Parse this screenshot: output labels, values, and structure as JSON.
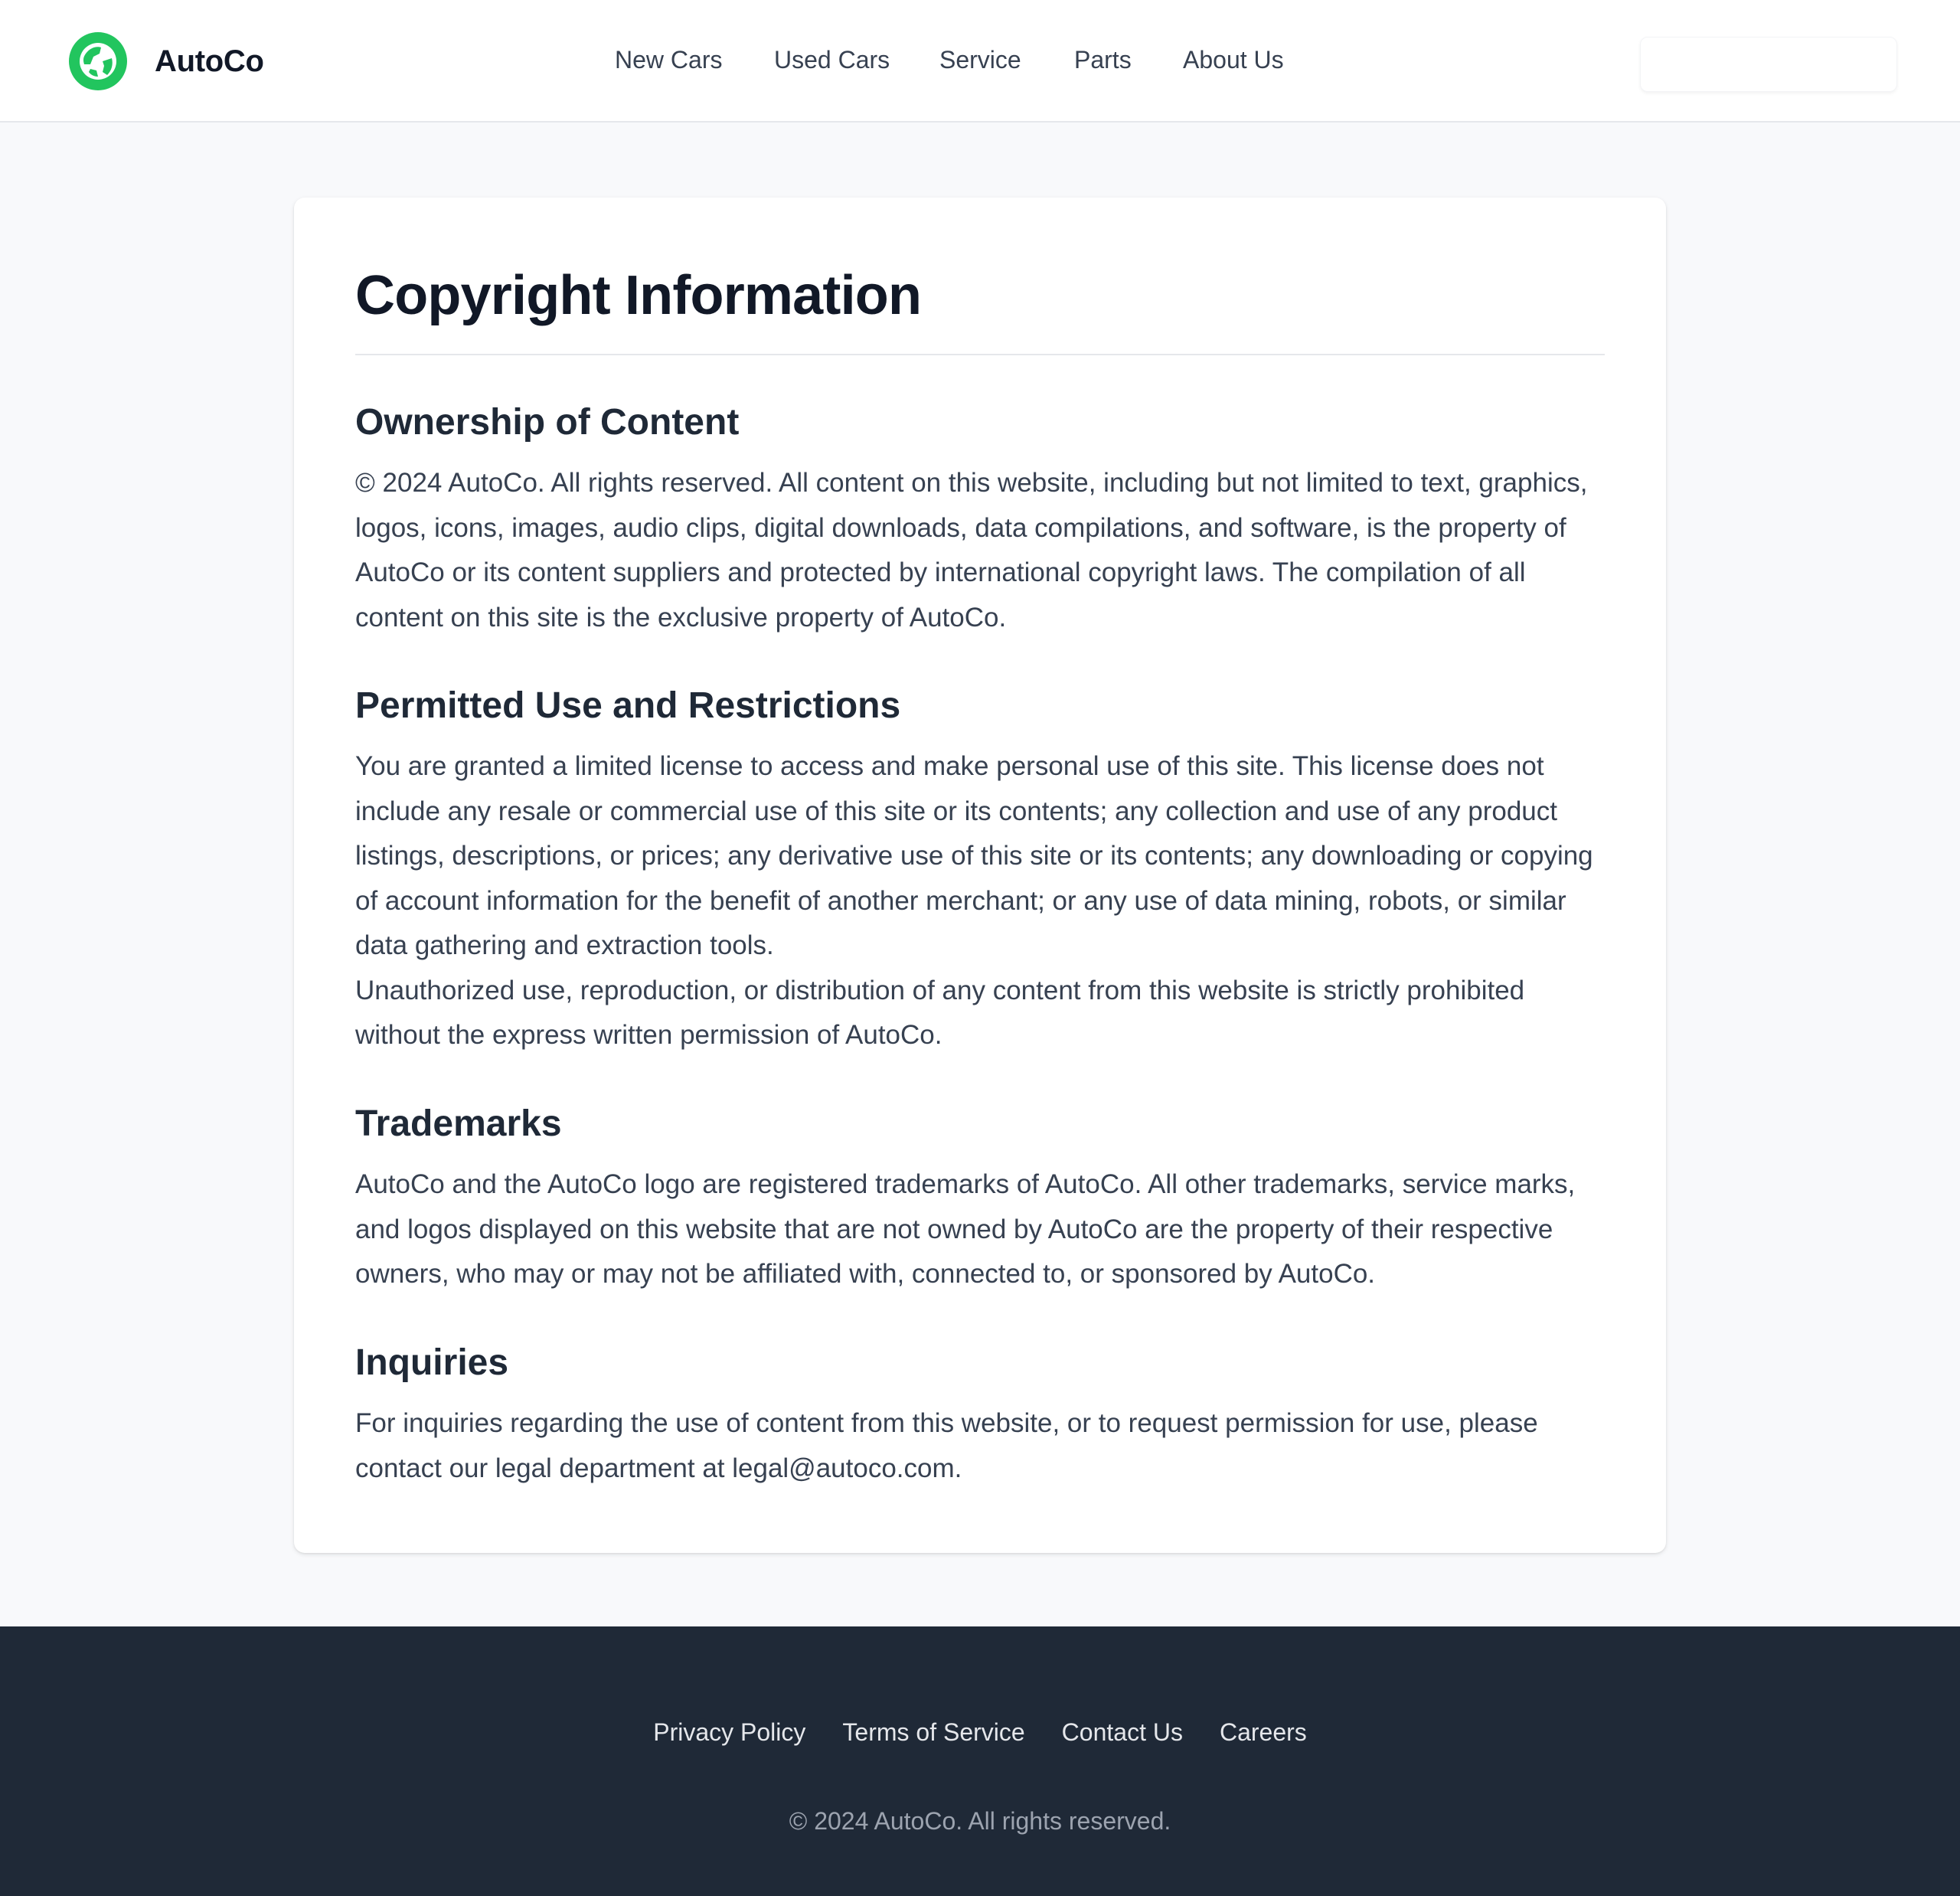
{
  "header": {
    "brand_name": "AutoCo",
    "logo_icon": "globe-icon",
    "brand_color": "#22c55e",
    "nav": [
      {
        "label": "New Cars"
      },
      {
        "label": "Used Cars"
      },
      {
        "label": "Service"
      },
      {
        "label": "Parts"
      },
      {
        "label": "About Us"
      }
    ]
  },
  "content": {
    "title": "Copyright Information",
    "sections": [
      {
        "heading": "Ownership of Content",
        "paragraphs": [
          "© 2024 AutoCo. All rights reserved. All content on this website, including but not limited to text, graphics, logos, icons, images, audio clips, digital downloads, data compilations, and software, is the property of AutoCo or its content suppliers and protected by international copyright laws. The compilation of all content on this site is the exclusive property of AutoCo."
        ]
      },
      {
        "heading": "Permitted Use and Restrictions",
        "paragraphs": [
          "You are granted a limited license to access and make personal use of this site. This license does not include any resale or commercial use of this site or its contents; any collection and use of any product listings, descriptions, or prices; any derivative use of this site or its contents; any downloading or copying of account information for the benefit of another merchant; or any use of data mining, robots, or similar data gathering and extraction tools.",
          "Unauthorized use, reproduction, or distribution of any content from this website is strictly prohibited without the express written permission of AutoCo."
        ]
      },
      {
        "heading": "Trademarks",
        "paragraphs": [
          "AutoCo and the AutoCo logo are registered trademarks of AutoCo. All other trademarks, service marks, and logos displayed on this website that are not owned by AutoCo are the property of their respective owners, who may or may not be affiliated with, connected to, or sponsored by AutoCo."
        ]
      },
      {
        "heading": "Inquiries",
        "paragraphs": [
          "For inquiries regarding the use of content from this website, or to request permission for use, please contact our legal department at legal@autoco.com."
        ]
      }
    ]
  },
  "footer": {
    "links": [
      {
        "label": "Privacy Policy"
      },
      {
        "label": "Terms of Service"
      },
      {
        "label": "Contact Us"
      },
      {
        "label": "Careers"
      }
    ],
    "copyright": "© 2024 AutoCo. All rights reserved."
  }
}
